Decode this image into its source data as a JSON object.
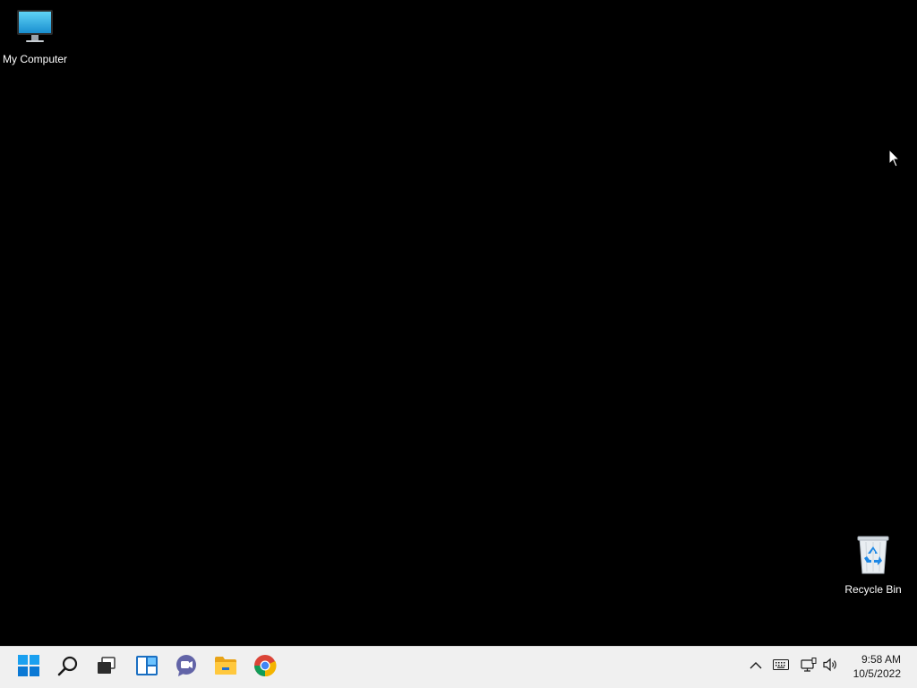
{
  "desktop": {
    "icons": [
      {
        "label": "My Computer",
        "icon": "monitor-icon"
      },
      {
        "label": "Recycle Bin",
        "icon": "recycle-bin-icon"
      }
    ]
  },
  "taskbar": {
    "apps": [
      {
        "name": "Start",
        "icon": "windows-start-icon"
      },
      {
        "name": "Search",
        "icon": "search-icon"
      },
      {
        "name": "Task View",
        "icon": "task-view-icon"
      },
      {
        "name": "Widgets",
        "icon": "widgets-icon"
      },
      {
        "name": "Chat",
        "icon": "chat-icon"
      },
      {
        "name": "File Explorer",
        "icon": "folder-icon"
      },
      {
        "name": "Google Chrome",
        "icon": "chrome-icon"
      }
    ],
    "tray": {
      "icons": [
        "chevron-up-icon",
        "keyboard-icon",
        "network-icon",
        "volume-icon"
      ],
      "time": "9:58 AM",
      "date": "10/5/2022"
    }
  },
  "colors": {
    "desktop_background": "#000000",
    "taskbar_background": "#f0f0f0",
    "start_blue": "#0078d4"
  }
}
